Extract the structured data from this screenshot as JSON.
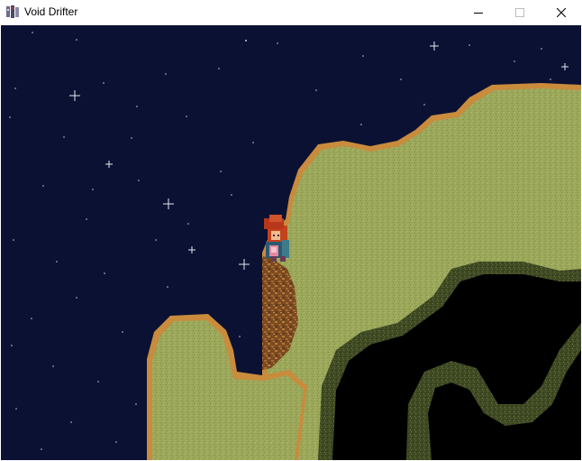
{
  "window": {
    "title": "Void Drifter",
    "controls": {
      "minimize_icon": "minimize-icon",
      "maximize_icon": "maximize-icon",
      "close_icon": "close-icon"
    }
  },
  "scene": {
    "sky_color": "#0b1133",
    "grass_color": "#9aa65a",
    "cliff_edge_color": "#c98b3c",
    "void_color": "#000000",
    "character": "red-haired-hero-sprite"
  }
}
